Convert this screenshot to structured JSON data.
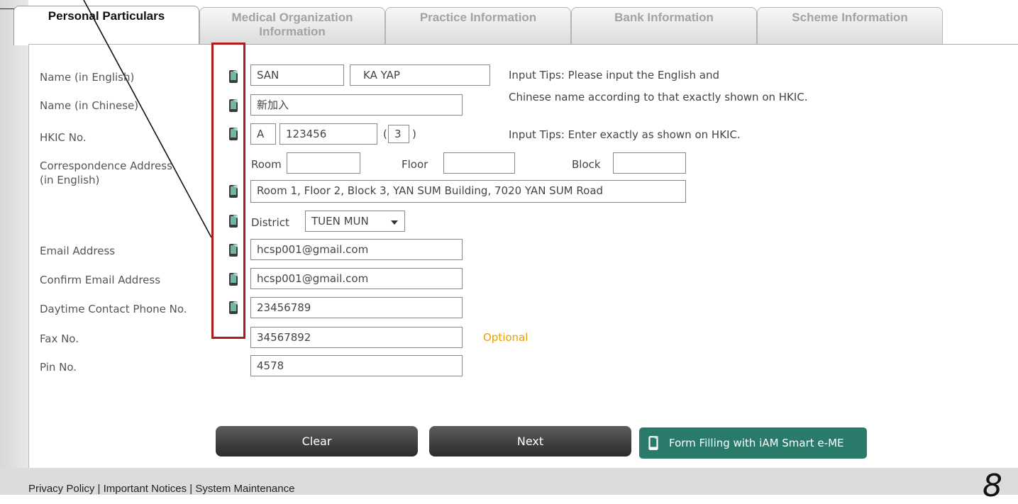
{
  "tabs": [
    {
      "label": "Personal Particulars",
      "sub": ""
    },
    {
      "label": "Medical Organization",
      "sub": "Information"
    },
    {
      "label": "Practice Information",
      "sub": ""
    },
    {
      "label": "Bank Information",
      "sub": ""
    },
    {
      "label": "Scheme Information",
      "sub": ""
    }
  ],
  "labels": {
    "name_en": "Name (in English)",
    "name_zh": "Name  (in Chinese)",
    "hkic": "HKIC No.",
    "address_1": "Correspondence Address",
    "address_2": "(in English)",
    "email": "Email Address",
    "confirm_email": "Confirm Email Address",
    "phone": "Daytime Contact Phone No.",
    "fax": "Fax No.",
    "pin": "Pin No."
  },
  "values": {
    "surname": "SAN",
    "given_name": "KA YAP",
    "name_zh": "新加入",
    "hkic_prefix": "A",
    "hkic_number": "123456",
    "hkic_check_open": "(",
    "hkic_check": "3",
    "hkic_check_close": ")",
    "room_label": "Room",
    "room": "",
    "floor_label": "Floor",
    "floor": "",
    "block_label": "Block",
    "block": "",
    "address": "Room 1, Floor 2, Block 3,  YAN SUM Building, 7020 YAN SUM Road",
    "district_label": "District",
    "district": "TUEN MUN",
    "email": "hcsp001@gmail.com",
    "confirm_email": "hcsp001@gmail.com",
    "phone": "23456789",
    "fax": "34567892",
    "pin": "4578"
  },
  "tips": {
    "name_1": "Input Tips: Please input the English and",
    "name_2": "Chinese name according to that exactly shown on HKIC.",
    "hkic": "Input Tips: Enter exactly as shown on HKIC.",
    "optional": "Optional"
  },
  "buttons": {
    "clear": "Clear",
    "next": "Next",
    "iam": "Form Filling with iAM Smart e-ME"
  },
  "footer": {
    "links": "Privacy Policy | Important Notices | System Maintenance",
    "page_number": "8"
  },
  "colors": {
    "highlight": "#b01c1c",
    "iam_button": "#2a7a6b",
    "optional": "#e8a000"
  }
}
